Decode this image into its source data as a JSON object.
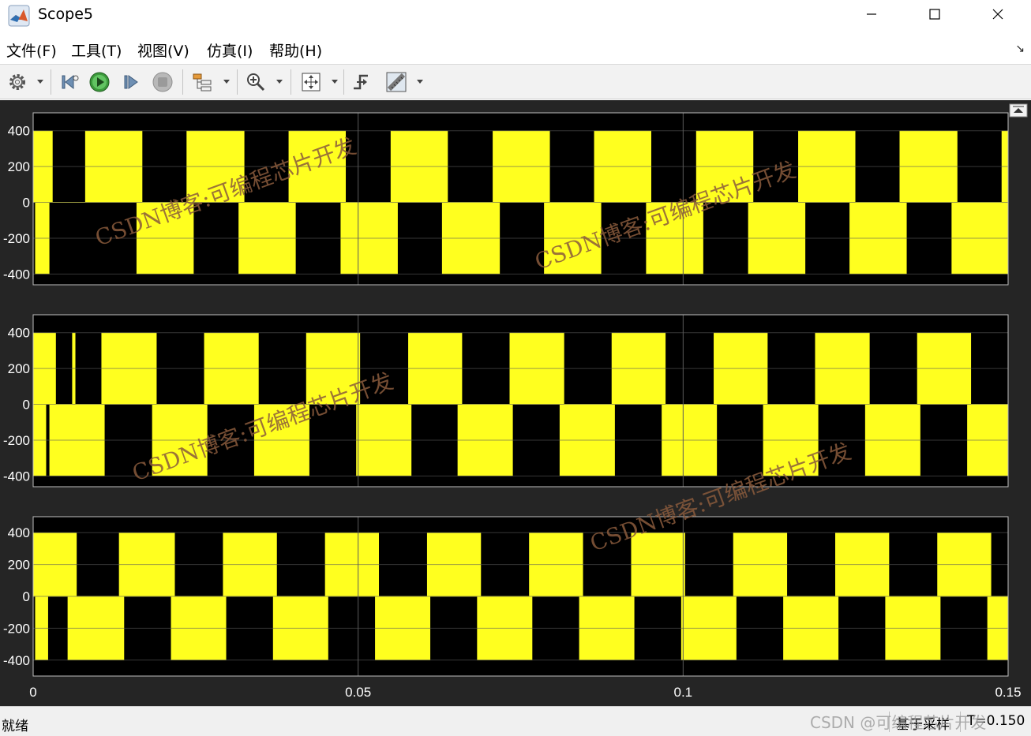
{
  "window": {
    "title": "Scope5",
    "icon": "matlab-logo-icon",
    "controls": [
      "minimize-icon",
      "maximize-icon",
      "close-icon"
    ]
  },
  "menu": {
    "items": [
      "文件(F)",
      "工具(T)",
      "视图(V)",
      "仿真(I)",
      "帮助(H)"
    ],
    "pin_glyph": "↘"
  },
  "toolbar": {
    "buttons": [
      {
        "name": "settings-icon",
        "has_dropdown": true
      },
      {
        "name": "step-back-icon",
        "has_dropdown": false
      },
      {
        "name": "run-icon",
        "has_dropdown": false
      },
      {
        "name": "step-forward-icon",
        "has_dropdown": false
      },
      {
        "name": "stop-icon",
        "has_dropdown": false
      },
      {
        "name": "signal-hierarchy-icon",
        "has_dropdown": true
      },
      {
        "name": "zoom-in-icon",
        "has_dropdown": true
      },
      {
        "name": "autoscale-icon",
        "has_dropdown": true
      },
      {
        "name": "trigger-icon",
        "has_dropdown": false
      },
      {
        "name": "measurement-ruler-icon",
        "has_dropdown": true
      }
    ]
  },
  "colors": {
    "scope_background": "#252525",
    "plot_background": "#000000",
    "signal": "#ffff1f",
    "axes_text": "#ffffff",
    "grid": "#5a5a5a",
    "watermark": "#8a5a3c"
  },
  "chart_data": [
    {
      "type": "line",
      "title": "",
      "xlabel": "",
      "ylabel": "",
      "xlim": [
        0,
        0.15
      ],
      "ylim": [
        -460,
        500
      ],
      "yticks": [
        400,
        200,
        0,
        -200,
        -400
      ],
      "xticks": [
        0,
        0.05,
        0.1,
        0.15
      ],
      "xtick_labels_shown": false,
      "grid": true,
      "series": [
        {
          "description": "line voltage PWM, ±400 V levels",
          "positive_pulse_intervals": [
            [
              0.0,
              0.003
            ],
            [
              0.008,
              0.0168
            ],
            [
              0.0236,
              0.0325
            ],
            [
              0.0393,
              0.0481
            ],
            [
              0.055,
              0.0638
            ],
            [
              0.0707,
              0.0795
            ],
            [
              0.0863,
              0.0951
            ],
            [
              0.102,
              0.1108
            ],
            [
              0.1177,
              0.1265
            ],
            [
              0.1333,
              0.1422
            ],
            [
              0.149,
              0.15
            ]
          ],
          "negative_pulse_intervals": [
            [
              0.0003,
              0.0025
            ],
            [
              0.0159,
              0.0247
            ],
            [
              0.0316,
              0.0404
            ],
            [
              0.0473,
              0.0561
            ],
            [
              0.0629,
              0.0718
            ],
            [
              0.0786,
              0.0874
            ],
            [
              0.0943,
              0.1031
            ],
            [
              0.11,
              0.1188
            ],
            [
              0.1256,
              0.1344
            ],
            [
              0.1413,
              0.15
            ]
          ]
        }
      ]
    },
    {
      "type": "line",
      "title": "",
      "xlabel": "",
      "ylabel": "",
      "xlim": [
        0,
        0.15
      ],
      "ylim": [
        -460,
        500
      ],
      "yticks": [
        400,
        200,
        0,
        -200,
        -400
      ],
      "xticks": [
        0,
        0.05,
        0.1,
        0.15
      ],
      "xtick_labels_shown": false,
      "grid": true,
      "series": [
        {
          "description": "line voltage PWM, ±400 V levels",
          "positive_pulse_intervals": [
            [
              0.0,
              0.0035
            ],
            [
              0.006,
              0.0065
            ],
            [
              0.0105,
              0.019
            ],
            [
              0.0263,
              0.0347
            ],
            [
              0.042,
              0.0503
            ],
            [
              0.0577,
              0.066
            ],
            [
              0.0733,
              0.0817
            ],
            [
              0.089,
              0.0973
            ],
            [
              0.1047,
              0.113
            ],
            [
              0.1203,
              0.1287
            ],
            [
              0.136,
              0.1443
            ]
          ],
          "negative_pulse_intervals": [
            [
              0.0,
              0.002
            ],
            [
              0.0025,
              0.011
            ],
            [
              0.0183,
              0.0268
            ],
            [
              0.034,
              0.0425
            ],
            [
              0.0497,
              0.0582
            ],
            [
              0.0653,
              0.0738
            ],
            [
              0.081,
              0.0895
            ],
            [
              0.0967,
              0.1052
            ],
            [
              0.1123,
              0.1208
            ],
            [
              0.128,
              0.1365
            ],
            [
              0.1437,
              0.15
            ]
          ]
        }
      ]
    },
    {
      "type": "line",
      "title": "",
      "xlabel": "",
      "ylabel": "",
      "xlim": [
        0,
        0.15
      ],
      "ylim": [
        -500,
        500
      ],
      "yticks": [
        400,
        200,
        0,
        -200,
        -400
      ],
      "xticks": [
        0,
        0.05,
        0.1,
        0.15
      ],
      "xtick_labels_shown": true,
      "grid": true,
      "series": [
        {
          "description": "line voltage PWM, ±400 V levels",
          "positive_pulse_intervals": [
            [
              0.0,
              0.0067
            ],
            [
              0.0132,
              0.0218
            ],
            [
              0.0292,
              0.0375
            ],
            [
              0.0449,
              0.0532
            ],
            [
              0.0606,
              0.0689
            ],
            [
              0.0763,
              0.0846
            ],
            [
              0.092,
              0.1003
            ],
            [
              0.1077,
              0.116
            ],
            [
              0.1234,
              0.1317
            ],
            [
              0.1391,
              0.1474
            ]
          ],
          "negative_pulse_intervals": [
            [
              0.0003,
              0.0023
            ],
            [
              0.0053,
              0.014
            ],
            [
              0.0212,
              0.0297
            ],
            [
              0.0369,
              0.0454
            ],
            [
              0.0526,
              0.0611
            ],
            [
              0.0683,
              0.0768
            ],
            [
              0.084,
              0.0925
            ],
            [
              0.0997,
              0.1082
            ],
            [
              0.1154,
              0.1239
            ],
            [
              0.1311,
              0.1396
            ],
            [
              0.1468,
              0.15
            ]
          ]
        }
      ]
    }
  ],
  "watermarks": [
    "CSDN博客:可编程芯片开发",
    "CSDN博客:可编程芯片开发",
    "CSDN博客:可编程芯片开发",
    "CSDN博客:可编程芯片开发"
  ],
  "status": {
    "left": "就绪",
    "sample": "基于采样",
    "time": "T=0.150",
    "csdn": "CSDN @可编程芯片开发"
  }
}
